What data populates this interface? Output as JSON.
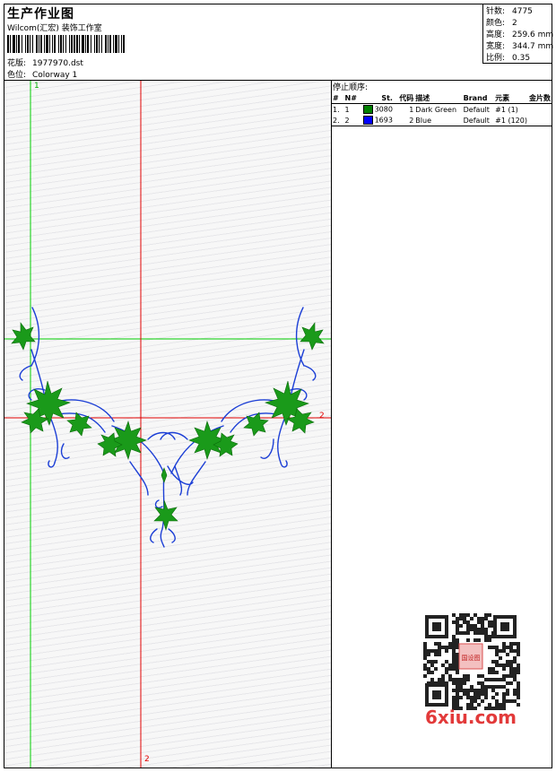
{
  "header": {
    "title": "生产作业图",
    "company": "Wilcom(汇宏) 装饰工作室",
    "design_label": "花版:",
    "design_value": "1977970.dst",
    "colorway_label": "色位:",
    "colorway_value": "Colorway 1"
  },
  "stats": [
    {
      "label": "针数:",
      "value": "4775"
    },
    {
      "label": "颜色:",
      "value": "2"
    },
    {
      "label": "高度:",
      "value": "259.6 mm"
    },
    {
      "label": "宽度:",
      "value": "344.7 mm"
    },
    {
      "label": "比例:",
      "value": "0.35"
    }
  ],
  "stop_sequence": {
    "title": "停止顺序:",
    "headers": [
      "#",
      "N#",
      "St.",
      "代码",
      "描述",
      "Brand",
      "元素",
      "金片数"
    ],
    "rows": [
      {
        "num": "1.",
        "n": "1",
        "stitches": "3080",
        "code": "1",
        "description": "Dark Green",
        "brand": "Default",
        "element": "#1 (1)",
        "color": "#008000"
      },
      {
        "num": "2.",
        "n": "2",
        "stitches": "1693",
        "code": "2",
        "description": "Blue",
        "brand": "Default",
        "element": "#1 (120)",
        "color": "#0000ff"
      }
    ]
  },
  "guides": {
    "green_top_label": "1",
    "red_right_label": "2",
    "red_bottom_label": "2"
  },
  "watermark": {
    "text": "6xiu.com",
    "qr_center_text": "国设图"
  },
  "colors": {
    "leaf_green": "#1a9a1a",
    "stem_blue": "#1c3fd6",
    "guide_green": "#00cc00",
    "guide_red": "#e00000"
  }
}
